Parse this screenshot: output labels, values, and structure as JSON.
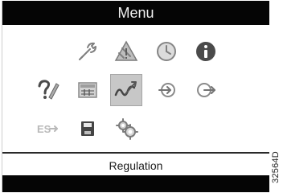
{
  "header": {
    "title": "Menu"
  },
  "menu": {
    "items": [
      {
        "icon": "wrench-icon",
        "name": "service-icon"
      },
      {
        "icon": "warning-icon",
        "name": "warning-icon"
      },
      {
        "icon": "clock-icon",
        "name": "timer-icon"
      },
      {
        "icon": "info-icon",
        "name": "info-icon"
      },
      {
        "icon": "pen-check-icon",
        "name": "settings-pen-icon"
      },
      {
        "icon": "data-panel-icon",
        "name": "data-panel-icon"
      },
      {
        "icon": "regulation-icon",
        "name": "regulation-icon"
      },
      {
        "icon": "arrow-in-icon",
        "name": "arrow-in-icon"
      },
      {
        "icon": "arrow-out-icon",
        "name": "arrow-out-icon"
      },
      {
        "icon": "es-icon",
        "name": "es-icon"
      },
      {
        "icon": "save-icon",
        "name": "save-icon"
      },
      {
        "icon": "gears-icon",
        "name": "gears-icon"
      }
    ],
    "selected": "regulation-icon",
    "es_label": "ES"
  },
  "footer": {
    "label": "Regulation"
  },
  "side_code": "32564D",
  "colors": {
    "bar": "#050505",
    "selected": "#c7c7c7",
    "icon": "#7f7f7f"
  }
}
